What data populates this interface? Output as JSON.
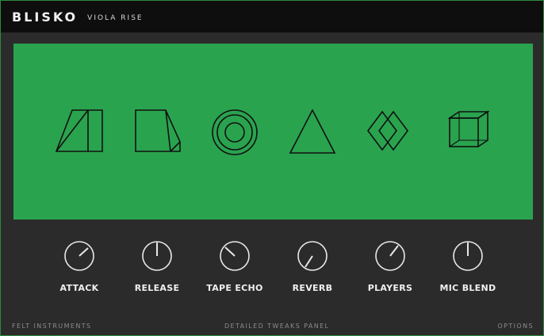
{
  "header": {
    "brand": "BLISKO",
    "product": "VIOLA RISE"
  },
  "stage": {
    "background_color": "#2aa34f",
    "shapes": [
      {
        "icon": "slanted-box-icon"
      },
      {
        "icon": "trapezoid-box-icon"
      },
      {
        "icon": "concentric-circle-icon"
      },
      {
        "icon": "triangle-icon"
      },
      {
        "icon": "double-diamond-icon"
      },
      {
        "icon": "cube-icon"
      }
    ]
  },
  "controls": {
    "knobs": [
      {
        "label": "ATTACK"
      },
      {
        "label": "RELEASE"
      },
      {
        "label": "TAPE ECHO"
      },
      {
        "label": "REVERB"
      },
      {
        "label": "PLAYERS"
      },
      {
        "label": "MIC BLEND"
      }
    ]
  },
  "footer": {
    "left": "FELT INSTRUMENTS",
    "center": "DETAILED TWEAKS PANEL",
    "right": "OPTIONS"
  }
}
